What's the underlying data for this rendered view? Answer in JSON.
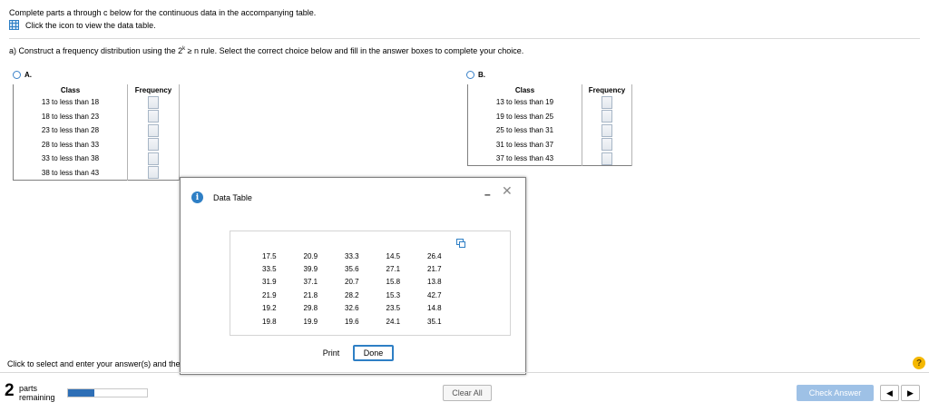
{
  "header": {
    "instruction": "Complete parts a through c below for the continuous data in the accompanying table.",
    "view_table_link": "Click the icon to view the data table."
  },
  "question": {
    "prefix": "a) Construct a frequency distribution using the 2",
    "superscript": "k",
    "suffix": " ≥ n rule. Select the correct choice below and fill in the answer boxes to complete your choice."
  },
  "choice_a": {
    "label": "A.",
    "col_class": "Class",
    "col_freq": "Frequency",
    "rows": [
      "13 to less than 18",
      "18 to less than 23",
      "23 to less than 28",
      "28 to less than 33",
      "33 to less than 38",
      "38 to less than 43"
    ]
  },
  "choice_b": {
    "label": "B.",
    "col_class": "Class",
    "col_freq": "Frequency",
    "rows": [
      "13 to less than 19",
      "19 to less than 25",
      "25 to less than 31",
      "31 to less than 37",
      "37 to less than 43"
    ]
  },
  "dialog": {
    "info_glyph": "i",
    "title": "Data Table",
    "minimize_glyph": "–",
    "close_glyph": "✕",
    "print_label": "Print",
    "done_label": "Done",
    "data": [
      [
        "17.5",
        "20.9",
        "33.3",
        "14.5",
        "26.4"
      ],
      [
        "33.5",
        "39.9",
        "35.6",
        "27.1",
        "21.7"
      ],
      [
        "31.9",
        "37.1",
        "20.7",
        "15.8",
        "13.8"
      ],
      [
        "21.9",
        "21.8",
        "28.2",
        "15.3",
        "42.7"
      ],
      [
        "19.2",
        "29.8",
        "32.6",
        "23.5",
        "14.8"
      ],
      [
        "19.8",
        "19.9",
        "19.6",
        "24.1",
        "35.1"
      ]
    ]
  },
  "footer": {
    "click_hint": "Click to select and enter your answer(s) and then click Check Answer.",
    "parts_count": "2",
    "parts_line1": "parts",
    "parts_line2": "remaining",
    "progress_fraction": 0.33,
    "clear_all": "Clear All",
    "check_answer": "Check Answer",
    "help_glyph": "?",
    "prev_glyph": "◀",
    "next_glyph": "▶"
  }
}
